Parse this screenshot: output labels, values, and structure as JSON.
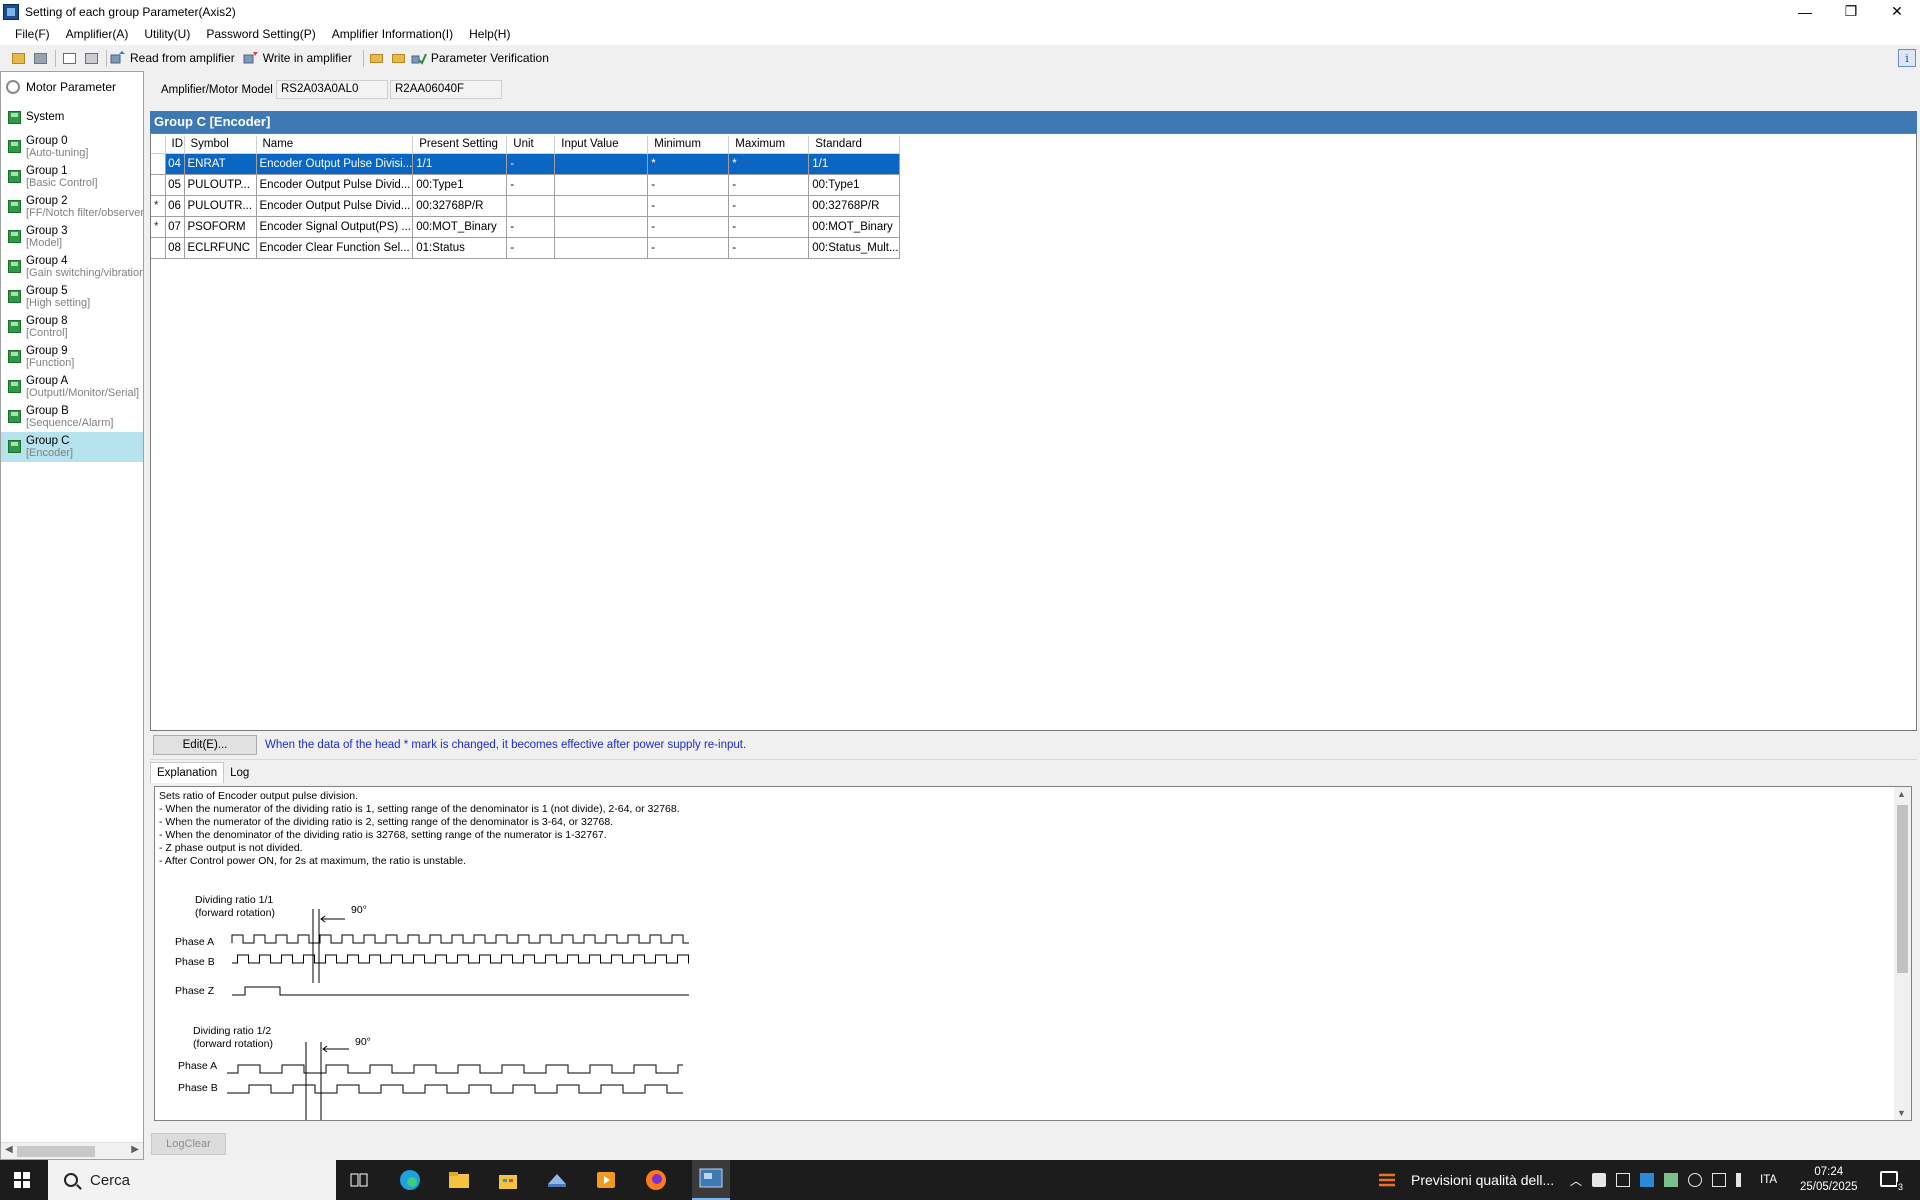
{
  "window": {
    "title": "Setting of each group Parameter(Axis2)",
    "buttons": {
      "minimize": "—",
      "restore": "❐",
      "close": "✕"
    }
  },
  "menu": [
    "File(F)",
    "Amplifier(A)",
    "Utility(U)",
    "Password Setting(P)",
    "Amplifier Information(I)",
    "Help(H)"
  ],
  "toolbar": {
    "read_label": "Read from amplifier",
    "write_label": "Write in amplifier",
    "verify_label": "Parameter Verification",
    "info_glyph": "i"
  },
  "sidebar": {
    "root": "Motor Parameter",
    "items": [
      {
        "name": "System",
        "sub": ""
      },
      {
        "name": "Group 0",
        "sub": "[Auto-tuning]"
      },
      {
        "name": "Group 1",
        "sub": "[Basic Control]"
      },
      {
        "name": "Group 2",
        "sub": "[FF/Notch filter/observer]"
      },
      {
        "name": "Group 3",
        "sub": "[Model]"
      },
      {
        "name": "Group 4",
        "sub": "[Gain switching/vibration"
      },
      {
        "name": "Group 5",
        "sub": "[High setting]"
      },
      {
        "name": "Group 8",
        "sub": "[Control]"
      },
      {
        "name": "Group 9",
        "sub": "[Function]"
      },
      {
        "name": "Group A",
        "sub": "[OutputI/Monitor/Serial]"
      },
      {
        "name": "Group B",
        "sub": "[Sequence/Alarm]"
      },
      {
        "name": "Group C",
        "sub": "[Encoder]"
      }
    ],
    "selected_index": 11
  },
  "model": {
    "label": "Amplifier/Motor Model",
    "amplifier": "RS2A03A0AL0",
    "motor": "R2AA06040F"
  },
  "group_title": "Group C [Encoder]",
  "table": {
    "columns": [
      "",
      "ID",
      "Symbol",
      "Name",
      "Present Setting",
      "Unit",
      "Input Value",
      "Minimum",
      "Maximum",
      "Standard"
    ],
    "rows": [
      {
        "mark": "",
        "id": "04",
        "symbol": "ENRAT",
        "name": "Encoder Output Pulse Divisi...",
        "present": "1/1",
        "unit": "-",
        "input": "",
        "min": "*",
        "max": "*",
        "std": "1/1"
      },
      {
        "mark": "",
        "id": "05",
        "symbol": "PULOUTP...",
        "name": "Encoder Output Pulse Divid...",
        "present": "00:Type1",
        "unit": "-",
        "input": "",
        "min": "-",
        "max": "-",
        "std": "00:Type1"
      },
      {
        "mark": "*",
        "id": "06",
        "symbol": "PULOUTR...",
        "name": "Encoder Output Pulse Divid...",
        "present": "00:32768P/R",
        "unit": "",
        "input": "",
        "min": "-",
        "max": "-",
        "std": "00:32768P/R"
      },
      {
        "mark": "*",
        "id": "07",
        "symbol": "PSOFORM",
        "name": "Encoder Signal Output(PS) ...",
        "present": "00:MOT_Binary",
        "unit": "-",
        "input": "",
        "min": "-",
        "max": "-",
        "std": "00:MOT_Binary"
      },
      {
        "mark": "",
        "id": "08",
        "symbol": "ECLRFUNC",
        "name": "Encoder Clear Function Sel...",
        "present": "01:Status",
        "unit": "-",
        "input": "",
        "min": "-",
        "max": "-",
        "std": "00:Status_Mult..."
      }
    ],
    "selected_index": 0
  },
  "edit_button": "Edit(E)...",
  "note": "When the data of the head * mark is changed, it becomes effective after power supply re-input.",
  "tabs": [
    "Explanation",
    "Log"
  ],
  "explanation": {
    "lines": [
      "Sets ratio of Encoder output pulse division.",
      "",
      "- When the numerator of the dividing ratio is 1, setting range of the denominator is 1 (not divide), 2-64, or 32768.",
      "- When the numerator of the dividing ratio is 2, setting range of the denominator is 3-64, or 32768.",
      "- When the denominator of the dividing ratio is 32768, setting range of the numerator is 1-32767.",
      "- Z phase output is not divided.",
      "- After Control power ON, for 2s at maximum, the ratio is unstable."
    ],
    "diagram": {
      "ratio1_title": "Dividing ratio 1/1",
      "ratio1_sub": "(forward rotation)",
      "ratio2_title": "Dividing ratio 1/2",
      "ratio2_sub": "(forward rotation)",
      "angle": "90°",
      "phase_a": "Phase A",
      "phase_b": "Phase B",
      "phase_z": "Phase Z"
    }
  },
  "logclear": "LogClear",
  "taskbar": {
    "search": "Cerca",
    "weather": "Previsioni qualità dell...",
    "language": "ITA",
    "time": "07:24",
    "date": "25/05/2025",
    "notifications": "3"
  },
  "colors": {
    "group_header": "#3f79b3",
    "selection": "#0a66c2",
    "sidebar_selected": "#b7e3ee",
    "note_text": "#1a2bd6",
    "taskbar": "#1c1c1c"
  }
}
